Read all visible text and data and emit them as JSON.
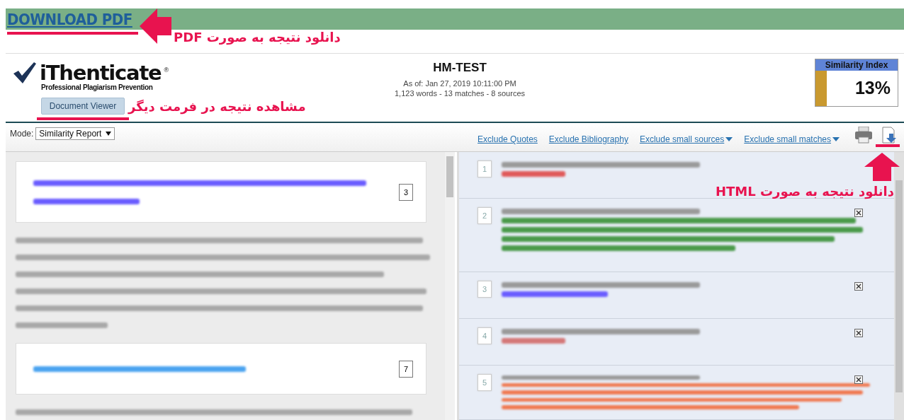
{
  "download_pdf": {
    "label": "DOWNLOAD PDF"
  },
  "annotations": [
    {
      "kind": "arrow-left",
      "text": "دانلود نتیجه به صورت PDF"
    },
    {
      "kind": "underline",
      "text": "مشاهده نتیجه در فرمت دیگر"
    },
    {
      "kind": "arrow-up",
      "text": "دانلود نتیجه به صورت HTML"
    }
  ],
  "header": {
    "logo_name": "iThenticate",
    "logo_mark": "®",
    "tagline": "Professional Plagiarism Prevention",
    "title": "HM-TEST",
    "date": "As of: Jan 27, 2019 10:11:00 PM",
    "stats": "1,123 words - 13 matches - 8 sources",
    "similarity_label": "Similarity Index",
    "similarity_value": "13%"
  },
  "document_viewer_button": "Document Viewer",
  "toolbar": {
    "mode_label": "Mode:",
    "mode": "Similarity Report",
    "links": [
      {
        "label": "Exclude Quotes",
        "dropdown": false
      },
      {
        "label": "Exclude Bibliography",
        "dropdown": false
      },
      {
        "label": "Exclude small sources",
        "dropdown": true
      },
      {
        "label": "Exclude small matches",
        "dropdown": true
      }
    ]
  },
  "document": {
    "blocks": [
      {
        "kind": "match",
        "number": "3"
      },
      {
        "kind": "text"
      },
      {
        "kind": "match",
        "number": "7"
      },
      {
        "kind": "text"
      }
    ]
  },
  "sources": [
    {
      "number": "1",
      "color": "#e05a5a",
      "removable": false
    },
    {
      "number": "2",
      "color": "#4a9a4a",
      "removable": true
    },
    {
      "number": "3",
      "color": "#6a5cff",
      "removable": true
    },
    {
      "number": "4",
      "color": "#d47878",
      "removable": true
    },
    {
      "number": "5",
      "color": "#f07850",
      "removable": true
    }
  ]
}
